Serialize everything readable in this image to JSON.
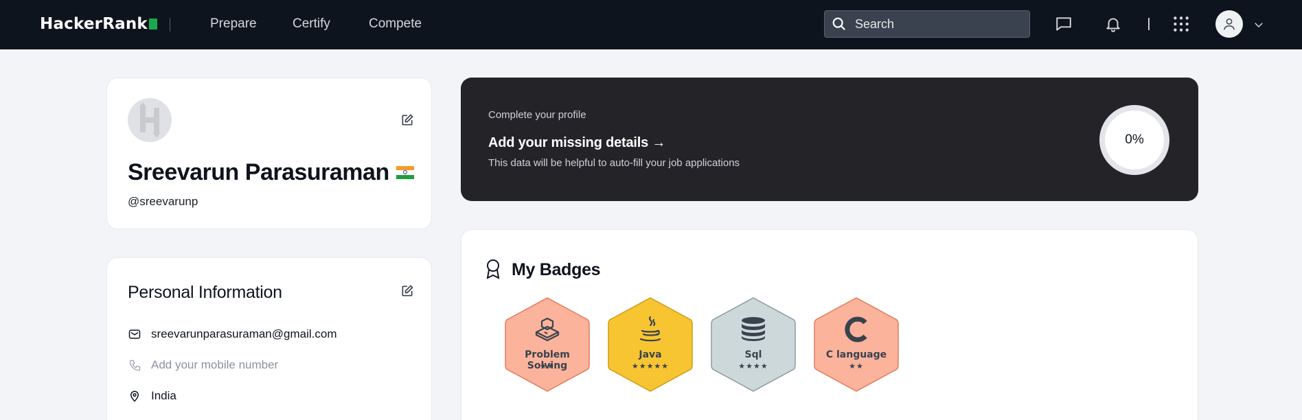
{
  "nav": {
    "logo": "HackerRank",
    "links": [
      "Prepare",
      "Certify",
      "Compete"
    ],
    "search_placeholder": "Search"
  },
  "profile": {
    "name": "Sreevarun Parasuraman",
    "handle": "@sreevarunp",
    "country_flag": "india-flag-icon"
  },
  "personal_info": {
    "title": "Personal Information",
    "email": "sreevarunparasuraman@gmail.com",
    "mobile_placeholder": "Add your mobile number",
    "location": "India"
  },
  "complete_profile": {
    "label": "Complete your profile",
    "title": "Add your missing details",
    "arrow": "→",
    "subtitle": "This data will be helpful to auto-fill your job applications",
    "percent": "0%"
  },
  "badges": {
    "title": "My Badges",
    "items": [
      {
        "name": "Problem Solving",
        "stars": 2,
        "stars_text": "★★",
        "color": "#f9a98a",
        "icon": "problem-solving-icon"
      },
      {
        "name": "Java",
        "stars": 5,
        "stars_text": "★★★★★",
        "color": "#f6c12e",
        "icon": "java-icon"
      },
      {
        "name": "Sql",
        "stars": 4,
        "stars_text": "★★★★",
        "color": "#c9d4d7",
        "icon": "database-icon"
      },
      {
        "name": "C language",
        "stars": 2,
        "stars_text": "★★",
        "color": "#f9a98a",
        "icon": "c-language-icon"
      }
    ]
  },
  "colors": {
    "nav_bg": "#0e141e",
    "brand_green": "#1ba94c",
    "dark_card": "#242428",
    "page_bg": "#f3f4f8"
  }
}
